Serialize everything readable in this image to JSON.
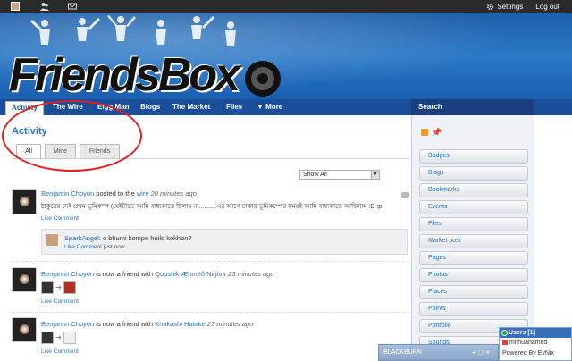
{
  "topbar": {
    "settings_label": "Settings",
    "logout_label": "Log out"
  },
  "header": {
    "logo_text": "FriendsBox"
  },
  "nav": {
    "tabs": [
      {
        "label": "Activity"
      },
      {
        "label": "The Wire"
      },
      {
        "label": "Elgg Man"
      },
      {
        "label": "Blogs"
      },
      {
        "label": "The Market"
      },
      {
        "label": "Files"
      },
      {
        "label": "▼ More"
      }
    ],
    "search_label": "Search"
  },
  "main": {
    "title": "Activity",
    "subtabs": [
      {
        "label": "All"
      },
      {
        "label": "Mine"
      },
      {
        "label": "Friends"
      }
    ],
    "filter_value": "Show All",
    "items": [
      {
        "actor": "Benjamin Choyon",
        "verb": " posted to the ",
        "target": "wire",
        "time": "20 minutes ago",
        "text": "ঠাকুরের সেই প্রথম ভূমিকম্প (যেইটাতে আমি বাধ্যকাত্তে ছিলাম না..........এর আগে ঢাকার ভূমিকম্পের সময়ই আমি বাধ্যকাত্তে আছিলাম :D :p",
        "like_label": "Like",
        "comment_label": "Comment",
        "comment": {
          "author": "SparkAngel",
          "text": ": o bhumi kompo hoilo kokhon?",
          "like_label": "Like",
          "comment_label": "Comment",
          "time": "just now"
        }
      },
      {
        "actor": "Benjamin Choyon",
        "verb": " is now a friend with ",
        "target": "Qoushik Æhmëð Nirjhor",
        "time": "23 minutes ago",
        "like_label": "Like",
        "comment_label": "Comment"
      },
      {
        "actor": "Benjamin Choyon",
        "verb": " is now a friend with ",
        "target": "Khakashi Hatake",
        "time": "23 minutes ago",
        "like_label": "Like",
        "comment_label": "Comment"
      }
    ]
  },
  "sidebar": {
    "items": [
      "Badges",
      "Blogs",
      "Bookmarks",
      "Events",
      "Files",
      "Market post",
      "Pages",
      "Photos",
      "Places",
      "Points",
      "Portfolio",
      "Sounds"
    ]
  },
  "chat": {
    "title": "Users",
    "count": "[1]",
    "user": "mithuahamed",
    "powered": "Powered By EvNix"
  },
  "taskbar": {
    "label": "BLACKBURN",
    "controls": "+□×"
  }
}
